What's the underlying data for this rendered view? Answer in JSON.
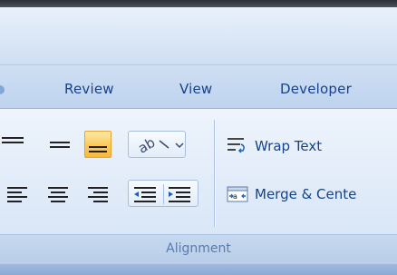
{
  "tabs": [
    "Review",
    "View",
    "Developer"
  ],
  "alignment": {
    "group_label": "Alignment",
    "wrap_text_label": "Wrap Text",
    "merge_label": "Merge & Cente",
    "orientation_icon": "orientation-icon",
    "active_button": "bottom-align-button"
  },
  "colors": {
    "accent_active": "#f9b93b",
    "tab_text": "#15428b",
    "ribbon_bg": "#dfeaf8",
    "group_label": "#5a7bab"
  }
}
